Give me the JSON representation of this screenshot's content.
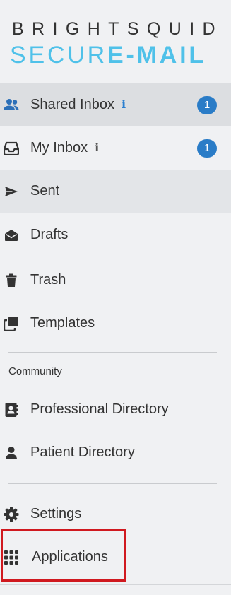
{
  "brand": {
    "top": "BRIGHTSQUID",
    "bottom_light": "SECUR",
    "bottom_bold": "E-MAIL",
    "accent_color": "#4fc1e9"
  },
  "nav": [
    {
      "label": "Shared Inbox",
      "icon": "users-icon",
      "info": "i",
      "badge": "1"
    },
    {
      "label": "My Inbox",
      "icon": "inbox-icon",
      "info": "i",
      "badge": "1"
    },
    {
      "label": "Sent",
      "icon": "paper-plane-icon"
    },
    {
      "label": "Drafts",
      "icon": "envelope-open-icon"
    },
    {
      "label": "Trash",
      "icon": "trash-icon"
    },
    {
      "label": "Templates",
      "icon": "clone-icon"
    }
  ],
  "community": {
    "heading": "Community",
    "items": [
      {
        "label": "Professional Directory",
        "icon": "address-card-icon"
      },
      {
        "label": "Patient Directory",
        "icon": "user-icon"
      }
    ]
  },
  "footer_nav": [
    {
      "label": "Settings",
      "icon": "gear-icon"
    },
    {
      "label": "Applications",
      "icon": "grid-icon"
    }
  ],
  "colors": {
    "badge": "#2a7cc7",
    "highlight_box": "#d0191f"
  }
}
